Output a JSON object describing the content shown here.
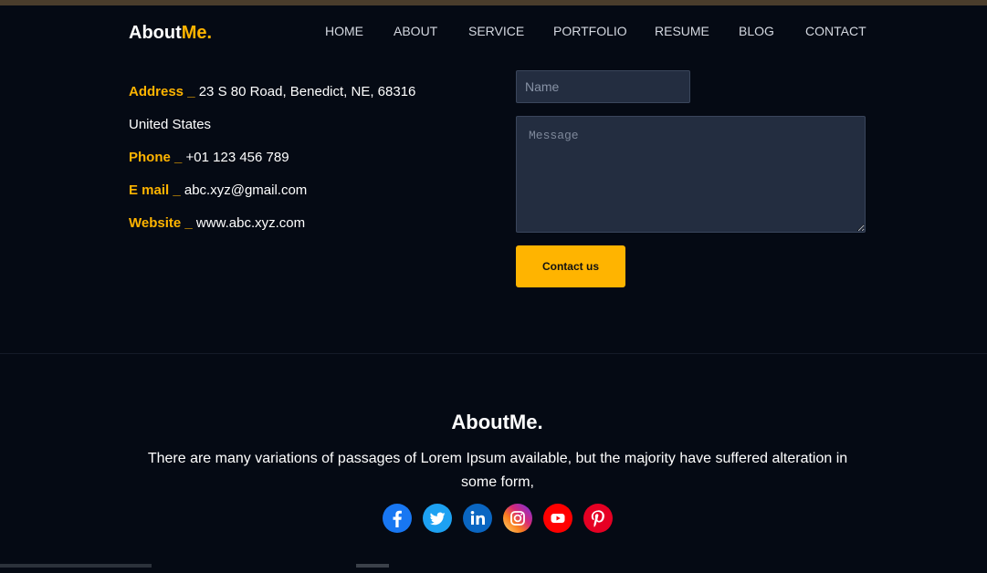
{
  "header": {
    "logo_main": "About",
    "logo_accent": "Me.",
    "nav": [
      {
        "label": "HOME"
      },
      {
        "label": "ABOUT"
      },
      {
        "label": "SERVICE"
      },
      {
        "label": "PORTFOLIO"
      },
      {
        "label": "RESUME"
      },
      {
        "label": "BLOG"
      },
      {
        "label": "CONTACT"
      }
    ]
  },
  "contact_info": {
    "address_label": "Address _",
    "address_value": "23 S 80 Road, Benedict, NE, 68316",
    "country": "United States",
    "phone_label": "Phone _",
    "phone_value": "+01 123 456 789",
    "email_label": "E mail _",
    "email_value": "abc.xyz@gmail.com",
    "website_label": "Website _",
    "website_value": "www.abc.xyz.com"
  },
  "form": {
    "name_placeholder": "Name",
    "message_placeholder": "Message",
    "submit_label": "Contact us"
  },
  "footer": {
    "title": "AboutMe.",
    "text": "There are many variations of passages of Lorem Ipsum available, but the majority have suffered alteration in some form,",
    "social": [
      {
        "icon": "facebook-icon"
      },
      {
        "icon": "twitter-icon"
      },
      {
        "icon": "linkedin-icon"
      },
      {
        "icon": "instagram-icon"
      },
      {
        "icon": "youtube-icon"
      },
      {
        "icon": "pinterest-icon"
      }
    ]
  },
  "colors": {
    "background": "#050a14",
    "accent": "#ffb400",
    "input_bg": "#232d40"
  }
}
